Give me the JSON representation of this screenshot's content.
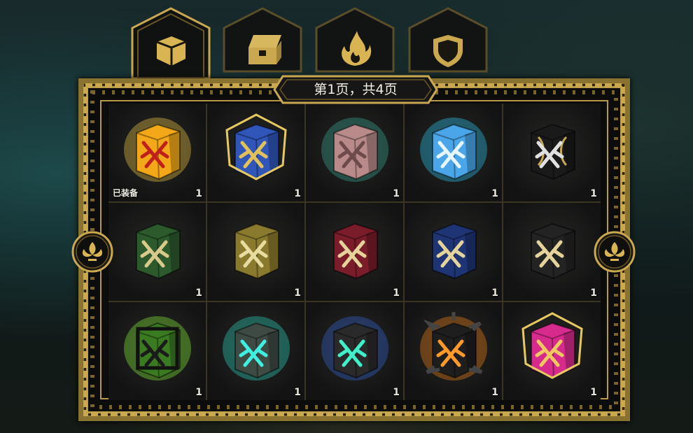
{
  "tabs": [
    {
      "name": "dice",
      "icon": "dice-icon",
      "active": true
    },
    {
      "name": "chest",
      "icon": "treasure-chest-icon",
      "active": false
    },
    {
      "name": "flame",
      "icon": "flame-icon",
      "active": false
    },
    {
      "name": "shield",
      "icon": "shield-icon",
      "active": false
    }
  ],
  "pager": {
    "label": "第1页，共4页"
  },
  "navigation": {
    "prev_icon": "fleur-de-lis-left-icon",
    "next_icon": "fleur-de-lis-right-icon"
  },
  "equipped_label": "已装备",
  "colors": {
    "gold": "#c9a850",
    "frame": "#8a7330"
  },
  "items": [
    {
      "count": "1",
      "equipped": true,
      "face": "#f2a818",
      "glow": "#ffd54a",
      "sword": "#c0201a",
      "style": "gem"
    },
    {
      "count": "1",
      "equipped": false,
      "face": "#2f56b8",
      "glow": "",
      "sword": "#e2c05a",
      "style": "star"
    },
    {
      "count": "1",
      "equipped": false,
      "face": "#b88a8a",
      "glow": "#3bb39b",
      "sword": "#6e4a4a",
      "style": "stone"
    },
    {
      "count": "1",
      "equipped": false,
      "face": "#4aa6e8",
      "glow": "#2fd0ff",
      "sword": "#e8f6ff",
      "style": "ice"
    },
    {
      "count": "1",
      "equipped": false,
      "face": "#1a1a1a",
      "glow": "",
      "sword": "#e0e0e0",
      "style": "ornate"
    },
    {
      "count": "1",
      "equipped": false,
      "face": "#2c5a2c",
      "glow": "",
      "sword": "#d9c98a",
      "style": "plain"
    },
    {
      "count": "1",
      "equipped": false,
      "face": "#8a7a2e",
      "glow": "",
      "sword": "#e8dca0",
      "style": "plain"
    },
    {
      "count": "1",
      "equipped": false,
      "face": "#7a1c2a",
      "glow": "",
      "sword": "#e4d39a",
      "style": "plain"
    },
    {
      "count": "1",
      "equipped": false,
      "face": "#1e3474",
      "glow": "",
      "sword": "#e4d39a",
      "style": "plain"
    },
    {
      "count": "1",
      "equipped": false,
      "face": "#232323",
      "glow": "",
      "sword": "#e4d39a",
      "style": "plain"
    },
    {
      "count": "1",
      "equipped": false,
      "face": "#3a7a20",
      "glow": "#8cff3a",
      "sword": "#1a1a1a",
      "style": "cage"
    },
    {
      "count": "1",
      "equipped": false,
      "face": "#3e4a44",
      "glow": "#2fe0c8",
      "sword": "#3ff0e0",
      "style": "rune"
    },
    {
      "count": "1",
      "equipped": false,
      "face": "#2a2a2a",
      "glow": "#3a6ae0",
      "sword": "#40f0c8",
      "style": "rune"
    },
    {
      "count": "1",
      "equipped": false,
      "face": "#1e1e1e",
      "glow": "#ff8a1a",
      "sword": "#ff9a2a",
      "style": "spiked"
    },
    {
      "count": "1",
      "equipped": false,
      "face": "#d62a8c",
      "glow": "",
      "sword": "#f0c860",
      "style": "star"
    }
  ]
}
